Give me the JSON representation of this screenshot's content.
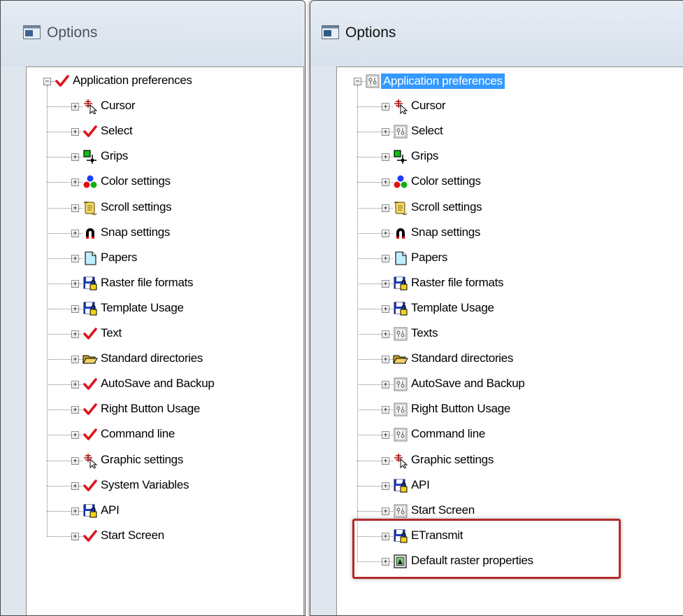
{
  "left_window": {
    "title": "Options",
    "root": {
      "label": "Application preferences",
      "icon": "checkmark-icon"
    },
    "items": [
      {
        "label": "Cursor",
        "icon": "cursor-crosshair-icon"
      },
      {
        "label": "Select",
        "icon": "checkmark-icon"
      },
      {
        "label": "Grips",
        "icon": "grips-icon"
      },
      {
        "label": "Color settings",
        "icon": "color-balls-icon"
      },
      {
        "label": "Scroll settings",
        "icon": "scroll-icon"
      },
      {
        "label": "Snap settings",
        "icon": "magnet-icon"
      },
      {
        "label": "Papers",
        "icon": "paper-icon"
      },
      {
        "label": "Raster file formats",
        "icon": "floppy-lock-icon"
      },
      {
        "label": "Template Usage",
        "icon": "floppy-lock-icon"
      },
      {
        "label": "Text",
        "icon": "checkmark-icon"
      },
      {
        "label": "Standard directories",
        "icon": "folder-open-icon"
      },
      {
        "label": "AutoSave and Backup",
        "icon": "checkmark-icon"
      },
      {
        "label": "Right Button Usage",
        "icon": "checkmark-icon"
      },
      {
        "label": "Command line",
        "icon": "checkmark-icon"
      },
      {
        "label": "Graphic settings",
        "icon": "cursor-crosshair-icon"
      },
      {
        "label": "System Variables",
        "icon": "checkmark-icon"
      },
      {
        "label": "API",
        "icon": "floppy-lock-icon"
      },
      {
        "label": "Start Screen",
        "icon": "checkmark-icon"
      }
    ]
  },
  "right_window": {
    "title": "Options",
    "root": {
      "label": "Application preferences",
      "icon": "settings-sliders-icon",
      "selected": true
    },
    "items": [
      {
        "label": "Cursor",
        "icon": "cursor-crosshair-icon"
      },
      {
        "label": "Select",
        "icon": "settings-sliders-icon"
      },
      {
        "label": "Grips",
        "icon": "grips-icon"
      },
      {
        "label": "Color settings",
        "icon": "color-balls-icon"
      },
      {
        "label": "Scroll settings",
        "icon": "scroll-icon"
      },
      {
        "label": "Snap settings",
        "icon": "magnet-icon"
      },
      {
        "label": "Papers",
        "icon": "paper-icon"
      },
      {
        "label": "Raster file formats",
        "icon": "floppy-lock-icon"
      },
      {
        "label": "Template Usage",
        "icon": "floppy-lock-icon"
      },
      {
        "label": "Texts",
        "icon": "settings-sliders-icon"
      },
      {
        "label": "Standard directories",
        "icon": "folder-open-icon"
      },
      {
        "label": "AutoSave and Backup",
        "icon": "settings-sliders-icon"
      },
      {
        "label": "Right Button Usage",
        "icon": "settings-sliders-icon"
      },
      {
        "label": "Command line",
        "icon": "settings-sliders-icon"
      },
      {
        "label": "Graphic settings",
        "icon": "cursor-crosshair-icon"
      },
      {
        "label": "API",
        "icon": "floppy-lock-icon"
      },
      {
        "label": "Start Screen",
        "icon": "settings-sliders-icon"
      },
      {
        "label": "ETransmit",
        "icon": "floppy-lock-icon"
      },
      {
        "label": "Default raster properties",
        "icon": "raster-properties-icon"
      }
    ],
    "highlighted_items": [
      "ETransmit",
      "Default raster properties"
    ]
  },
  "colors": {
    "selection": "#3399ff",
    "highlight_border": "#b22a2a",
    "checkmark": "#e0141e"
  }
}
